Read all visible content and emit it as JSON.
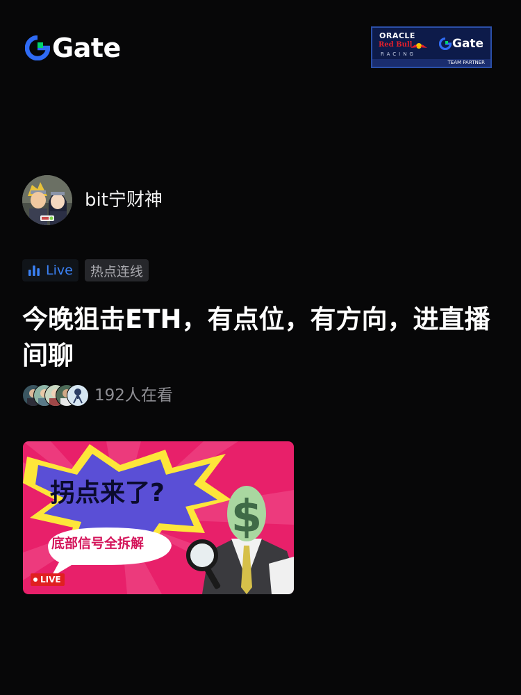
{
  "header": {
    "logo_text": "Gate",
    "partner": {
      "line1": "ORACLE",
      "line2": "Red Bull",
      "line3": "RACING",
      "gate_text": "Gate",
      "tag": "TEAM PARTNER"
    }
  },
  "host": {
    "username": "bit宁财神"
  },
  "tags": {
    "live_label": "Live",
    "topic_label": "热点连线"
  },
  "stream": {
    "title": "今晚狙击ETH，有点位，有方向，进直播间聊",
    "viewer_text": "192人在看"
  },
  "thumbnail": {
    "title": "拐点来了?",
    "subtitle": "底部信号全拆解",
    "live_badge": "LIVE"
  },
  "colors": {
    "background": "#070708",
    "accent_blue": "#3b82f6",
    "brand_green": "#00d36e",
    "thumb_pink": "#e8206a",
    "thumb_yellow": "#fde63a"
  }
}
